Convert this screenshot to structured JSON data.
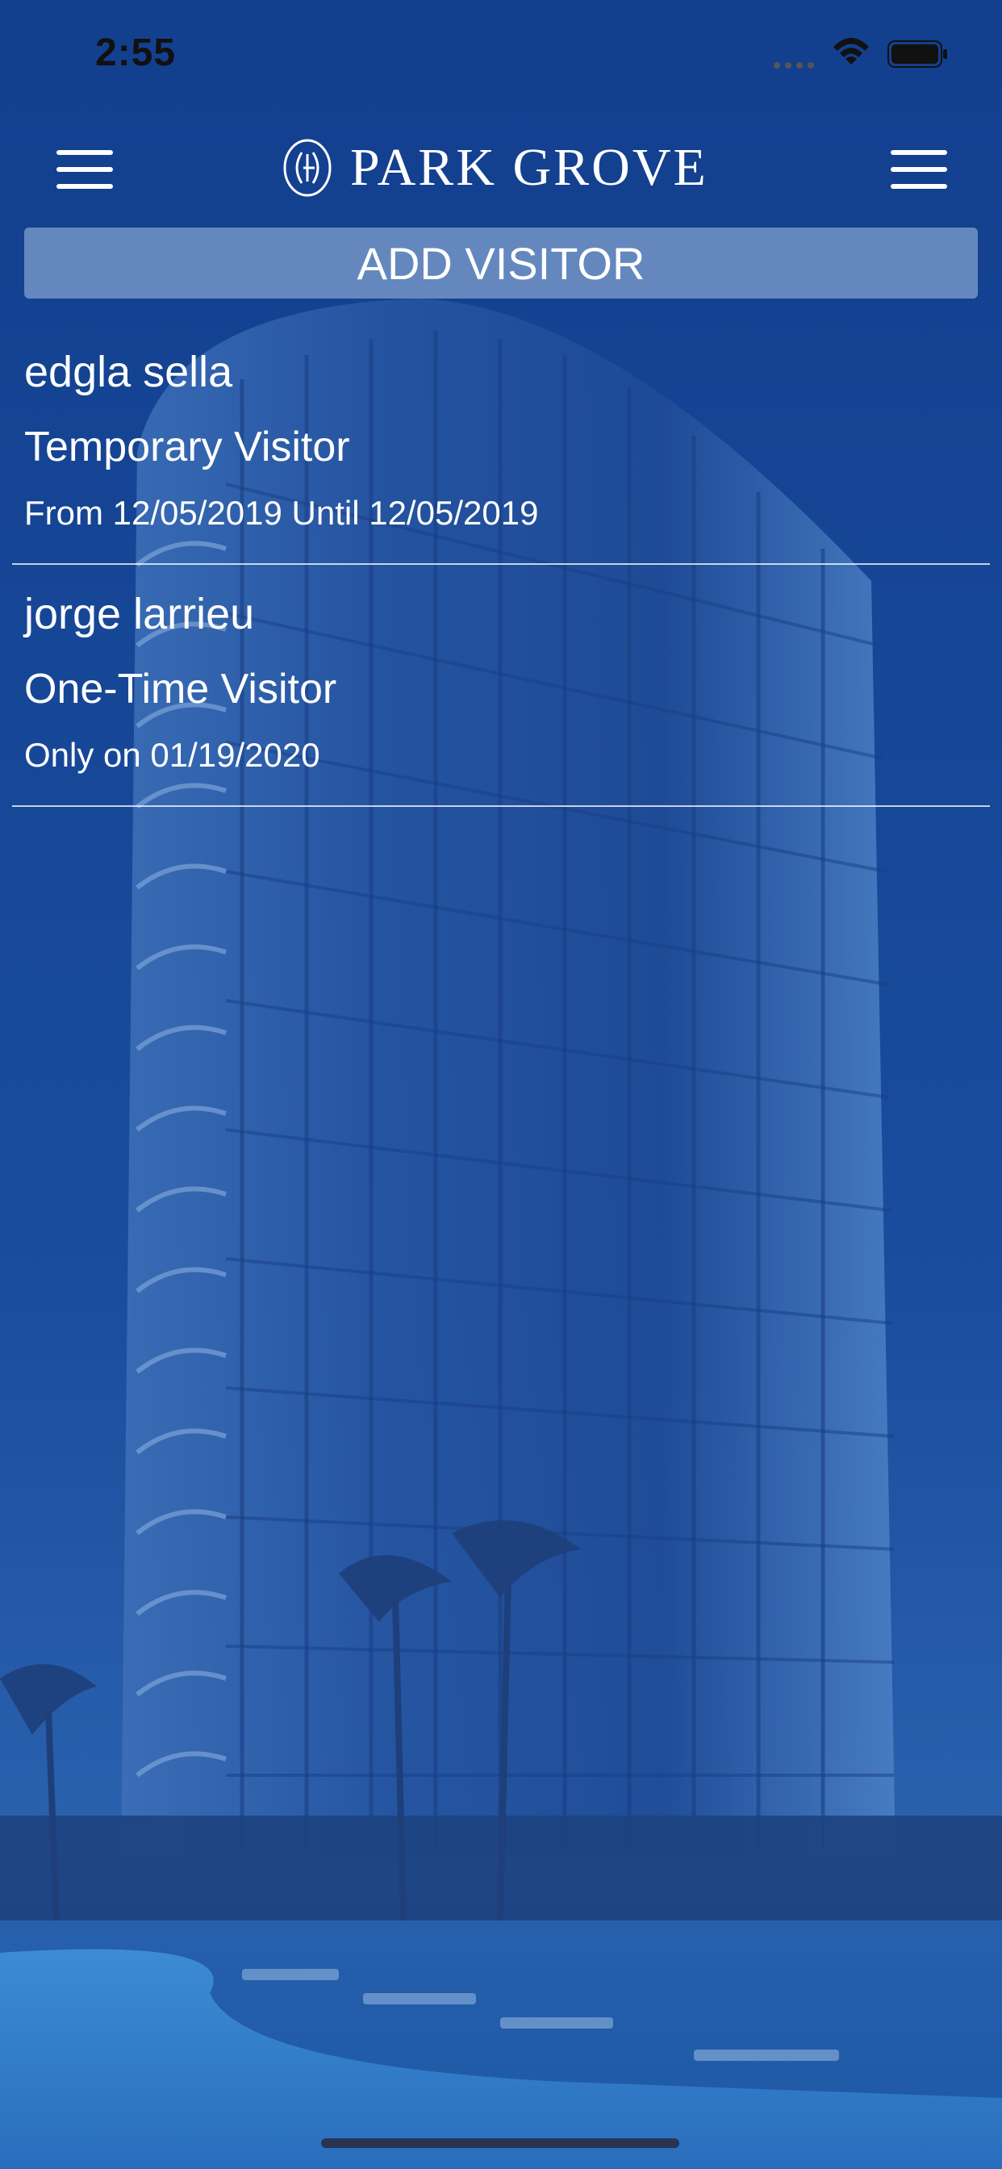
{
  "status_bar": {
    "time": "2:55",
    "icons": [
      "signal-icon",
      "wifi-icon",
      "battery-icon"
    ]
  },
  "header": {
    "brand": "PARK GROVE",
    "left_icon": "hamburger-menu-icon",
    "right_icon": "hamburger-menu-icon"
  },
  "actions": {
    "add_visitor_label": "ADD VISITOR"
  },
  "visitors": [
    {
      "name": "edgla sella",
      "type": "Temporary Visitor",
      "dates": "From 12/05/2019 Until 12/05/2019"
    },
    {
      "name": "jorge larrieu",
      "type": "One-Time Visitor",
      "dates": "Only on 01/19/2020"
    }
  ],
  "colors": {
    "overlay_blue": "#123f8e",
    "button_fill": "#b4cdeb",
    "text": "#ffffff"
  }
}
